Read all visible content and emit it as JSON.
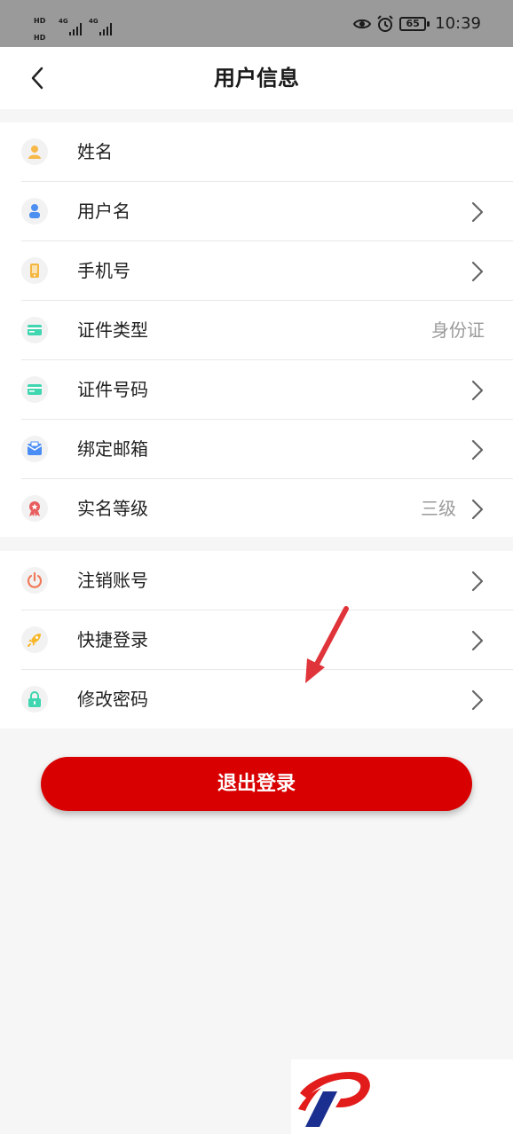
{
  "status_bar": {
    "hd_label": "HD",
    "network_1": "4G",
    "network_2": "4G",
    "battery": "65",
    "time": "10:39"
  },
  "header": {
    "title": "用户信息"
  },
  "section_1": [
    {
      "label": "姓名",
      "value": "",
      "icon": "user-icon",
      "icon_color": "#f7b84a",
      "chevron": false
    },
    {
      "label": "用户名",
      "value": "",
      "icon": "person-icon",
      "icon_color": "#4d8ff0",
      "chevron": true
    },
    {
      "label": "手机号",
      "value": "",
      "icon": "phone-icon",
      "icon_color": "#f5b63f",
      "chevron": true
    },
    {
      "label": "证件类型",
      "value": "身份证",
      "icon": "card-icon",
      "icon_color": "#3fd6b0",
      "chevron": false
    },
    {
      "label": "证件号码",
      "value": "",
      "icon": "card-icon",
      "icon_color": "#3fd6b0",
      "chevron": true
    },
    {
      "label": "绑定邮箱",
      "value": "",
      "icon": "mail-icon",
      "icon_color": "#4a8df5",
      "chevron": true
    },
    {
      "label": "实名等级",
      "value": "三级",
      "icon": "badge-icon",
      "icon_color": "#e85d5d",
      "chevron": true
    }
  ],
  "section_2": [
    {
      "label": "注销账号",
      "value": "",
      "icon": "power-icon",
      "icon_color": "#f07a5a",
      "chevron": true
    },
    {
      "label": "快捷登录",
      "value": "",
      "icon": "rocket-icon",
      "icon_color": "#f7b72b",
      "chevron": true
    },
    {
      "label": "修改密码",
      "value": "",
      "icon": "lock-icon",
      "icon_color": "#3fd6b0",
      "chevron": true
    }
  ],
  "logout_button": "退出登录",
  "colors": {
    "accent_red": "#d80000",
    "annotation_arrow": "#e0343b",
    "watermark_red": "#e21b1b",
    "watermark_blue": "#1a2f8f"
  }
}
